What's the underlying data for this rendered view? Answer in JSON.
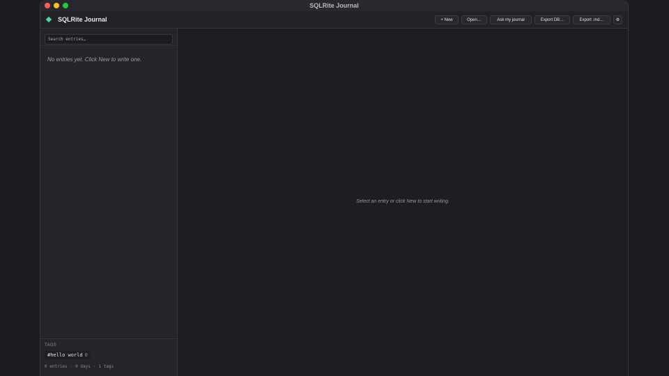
{
  "window": {
    "title": "SQLRite Journal"
  },
  "header": {
    "app_name": "SQLRite Journal",
    "brand_icon": "diamond-icon",
    "brand_color": "#4cd59a"
  },
  "toolbar": {
    "new_label": "+ New",
    "open_label": "Open…",
    "ask_label": "Ask my journal",
    "export_db_label": "Export DB…",
    "export_md_label": "Export .md…",
    "settings_label": "⚙"
  },
  "sidebar": {
    "search_placeholder": "Search entries…",
    "empty_message": "No entries yet. Click New to write one.",
    "tags_heading": "TAGS",
    "tags": [
      {
        "name": "#hello world",
        "count": "0"
      }
    ],
    "stats": {
      "entries": "0 entries",
      "sep1": "·",
      "days": "0 days",
      "sep2": "·",
      "tags": "1 tags"
    }
  },
  "main": {
    "placeholder": "Select an entry or click New to start writing."
  }
}
